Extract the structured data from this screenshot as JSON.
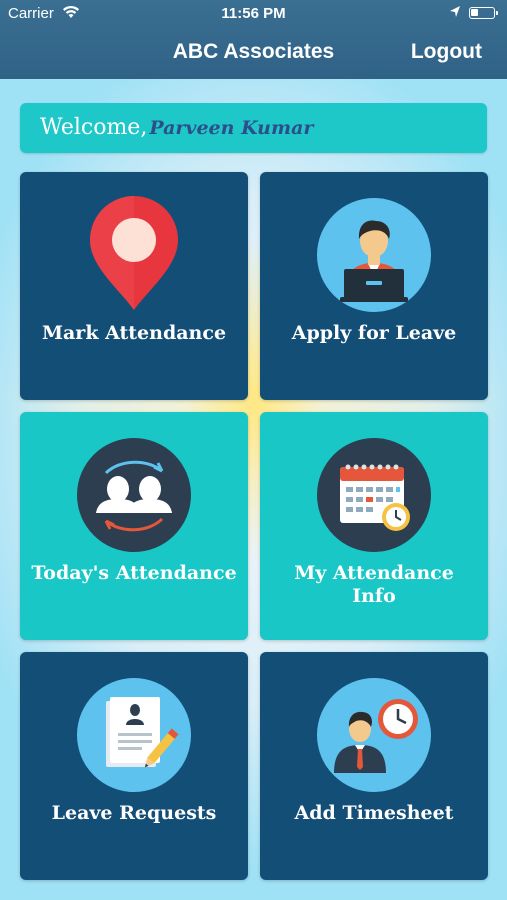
{
  "status_bar": {
    "carrier": "Carrier",
    "time": "11:56 PM",
    "battery_level": 0.35
  },
  "nav": {
    "title": "ABC Associates",
    "logout": "Logout"
  },
  "welcome": {
    "greeting": "Welcome,",
    "user_name": "Parveen Kumar"
  },
  "tiles": [
    {
      "label": "Mark Attendance",
      "icon": "location-pin-icon"
    },
    {
      "label": "Apply for Leave",
      "icon": "person-laptop-icon"
    },
    {
      "label": "Today's Attendance",
      "icon": "users-sync-icon"
    },
    {
      "label": "My Attendance",
      "label_line2": "Info",
      "icon": "calendar-clock-icon"
    },
    {
      "label": "Leave Requests",
      "icon": "document-pencil-icon"
    },
    {
      "label": "Add Timesheet",
      "icon": "person-clock-icon"
    }
  ],
  "colors": {
    "nav_bar": "#2f6286",
    "dark_tile": "#134e76",
    "teal_tile": "#18c7c6",
    "icon_circle_light": "#5ec2ef",
    "icon_circle_dark": "#2c3e50",
    "pin_red": "#e8363f"
  }
}
